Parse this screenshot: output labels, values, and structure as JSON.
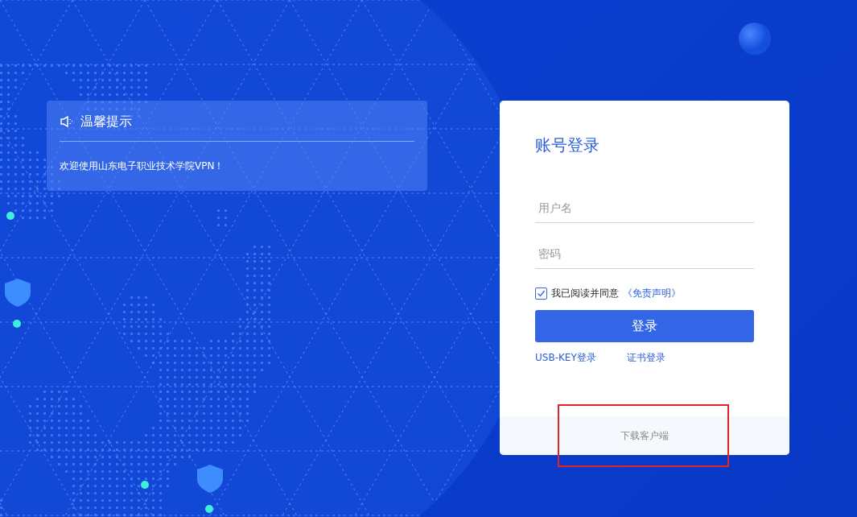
{
  "notice": {
    "title": "温馨提示",
    "message": "欢迎使用山东电子职业技术学院VPN！"
  },
  "login": {
    "title": "账号登录",
    "fields": [
      {
        "placeholder": "用户名"
      },
      {
        "placeholder": "密码"
      }
    ],
    "agreement": {
      "checked": true,
      "text": "我已阅读并同意",
      "link": "《免责声明》"
    },
    "submit": "登录",
    "alt_links": [
      "USB-KEY登录",
      "证书登录"
    ],
    "footer_link": "下载客户端"
  }
}
